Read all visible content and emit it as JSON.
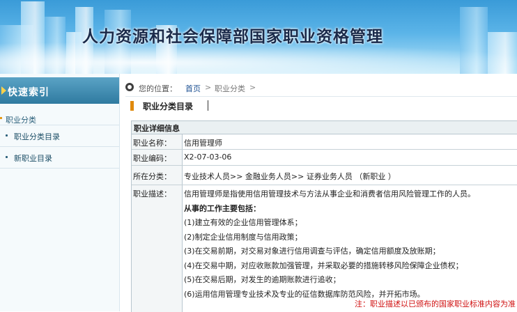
{
  "header": {
    "title": "人力资源和社会保障部国家职业资格管理"
  },
  "sidebar": {
    "heading": "快速索引",
    "category": "职业分类",
    "items": [
      {
        "label": "职业分类目录"
      },
      {
        "label": "新职业目录"
      }
    ]
  },
  "breadcrumb": {
    "label": "您的位置：",
    "home": "首页",
    "sep": ">",
    "current": "职业分类"
  },
  "section": {
    "title": "职业分类目录"
  },
  "detail": {
    "header": "职业详细信息",
    "rows": [
      {
        "key": "职业名称：",
        "value": "信用管理师"
      },
      {
        "key": "职业编码：",
        "value": "X2-07-03-06"
      },
      {
        "key": "所在分类：",
        "value": "专业技术人员>> 金融业务人员>> 证券业务人员 （新职业 ）"
      }
    ],
    "description": {
      "key": "职业描述：",
      "intro": "信用管理师是指使用信用管理技术与方法从事企业和消费者信用风险管理工作的人员。",
      "tasks_title": "从事的工作主要包括：",
      "tasks": [
        "(1)建立有效的企业信用管理体系；",
        "(2)制定企业信用制度与信用政策；",
        "(3)在交易前期，对交易对象进行信用调查与评估，确定信用额度及放账期；",
        "(4)在交易中期，对应收账款加强管理，并采取必要的措施转移风险保障企业债权；",
        "(5)在交易后期，对发生的逾期账款进行追收；",
        "(6)运用信用管理专业技术及专业的征信数据库防范风险，并开拓市场。"
      ]
    },
    "note": "注：职业描述以已颁布的国家职业标准内容为准"
  },
  "colors": {
    "sidebar_header": "#2f7aa0",
    "accent": "#e08a0c",
    "note": "#d01010",
    "link": "#1b4f91"
  }
}
